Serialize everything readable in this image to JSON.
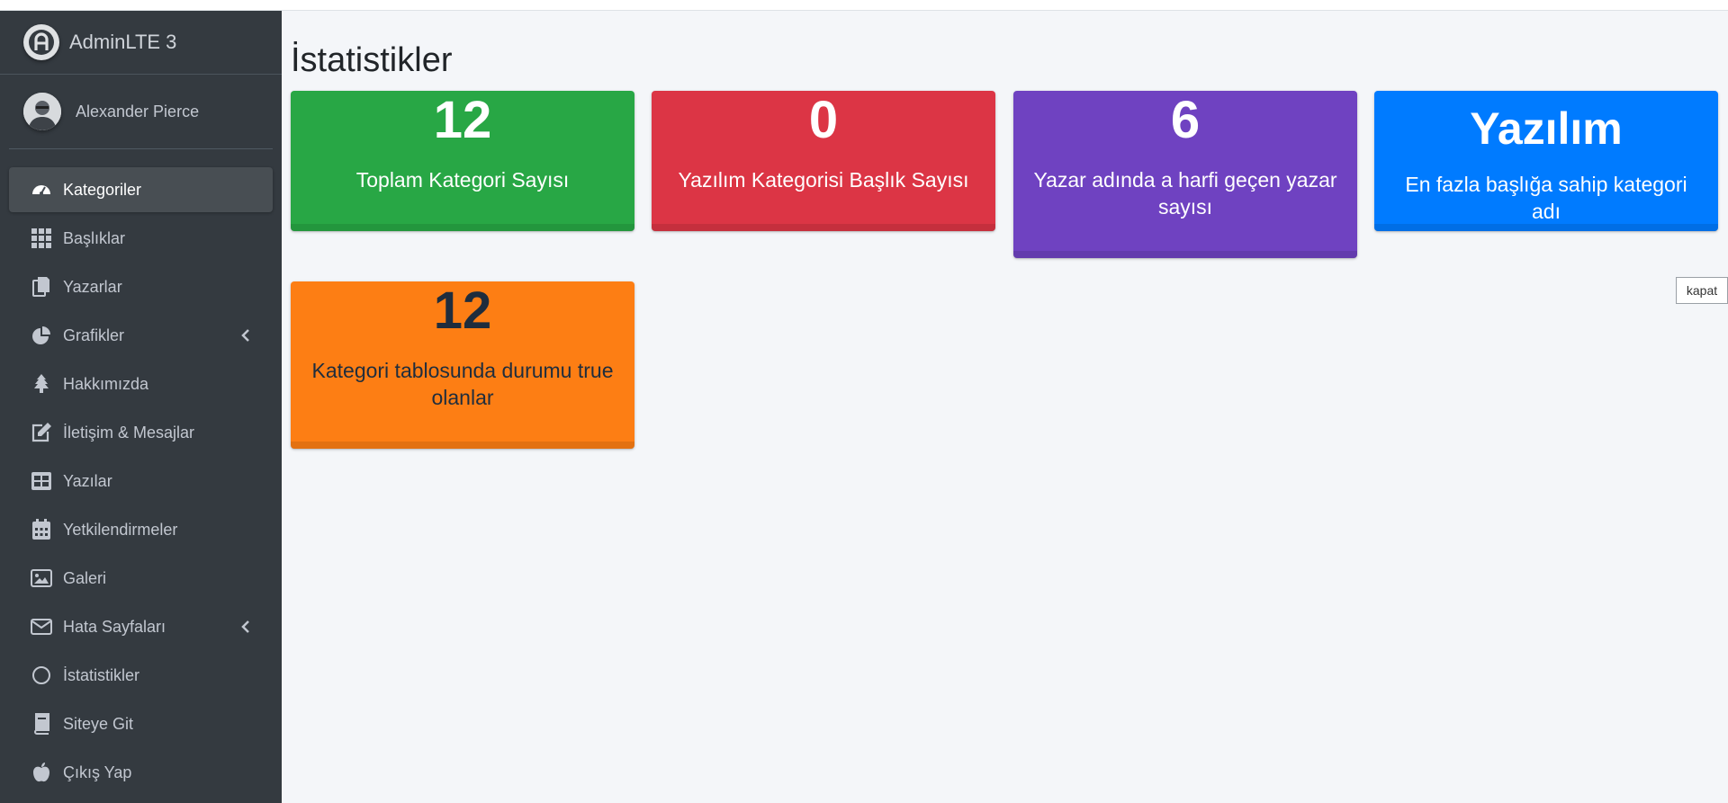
{
  "brand": {
    "name": "AdminLTE 3"
  },
  "user": {
    "name": "Alexander Pierce"
  },
  "nav": [
    {
      "label": "Kategoriler",
      "icon": "dashboard-gauge-icon",
      "active": true
    },
    {
      "label": "Başlıklar",
      "icon": "grid-icon"
    },
    {
      "label": "Yazarlar",
      "icon": "copy-icon"
    },
    {
      "label": "Grafikler",
      "icon": "pie-chart-icon",
      "arrow": true
    },
    {
      "label": "Hakkımızda",
      "icon": "tree-icon"
    },
    {
      "label": "İletişim & Mesajlar",
      "icon": "edit-icon"
    },
    {
      "label": "Yazılar",
      "icon": "table-icon"
    },
    {
      "label": "Yetkilendirmeler",
      "icon": "calendar-icon"
    },
    {
      "label": "Galeri",
      "icon": "image-icon"
    },
    {
      "label": "Hata Sayfaları",
      "icon": "envelope-icon",
      "arrow": true
    },
    {
      "label": "İstatistikler",
      "icon": "circle-icon"
    },
    {
      "label": "Siteye Git",
      "icon": "book-icon"
    },
    {
      "label": "Çıkış Yap",
      "icon": "apple-icon"
    }
  ],
  "page": {
    "title": "İstatistikler"
  },
  "stats": [
    {
      "value": "12",
      "label": "Toplam Kategori Sayısı",
      "color": "#28a745"
    },
    {
      "value": "0",
      "label": "Yazılım Kategorisi Başlık Sayısı",
      "color": "#dc3545"
    },
    {
      "value": "6",
      "label": "Yazar adında a harfi geçen yazar sayısı",
      "color": "#6f42c1"
    },
    {
      "value": "Yazılım",
      "label": "En fazla başlığa sahip kategori adı",
      "color": "#007bff"
    },
    {
      "value": "12",
      "label": "Kategori tablosunda durumu true olanlar",
      "color": "#fd7e14"
    }
  ],
  "close_button": {
    "label": "kapat"
  }
}
